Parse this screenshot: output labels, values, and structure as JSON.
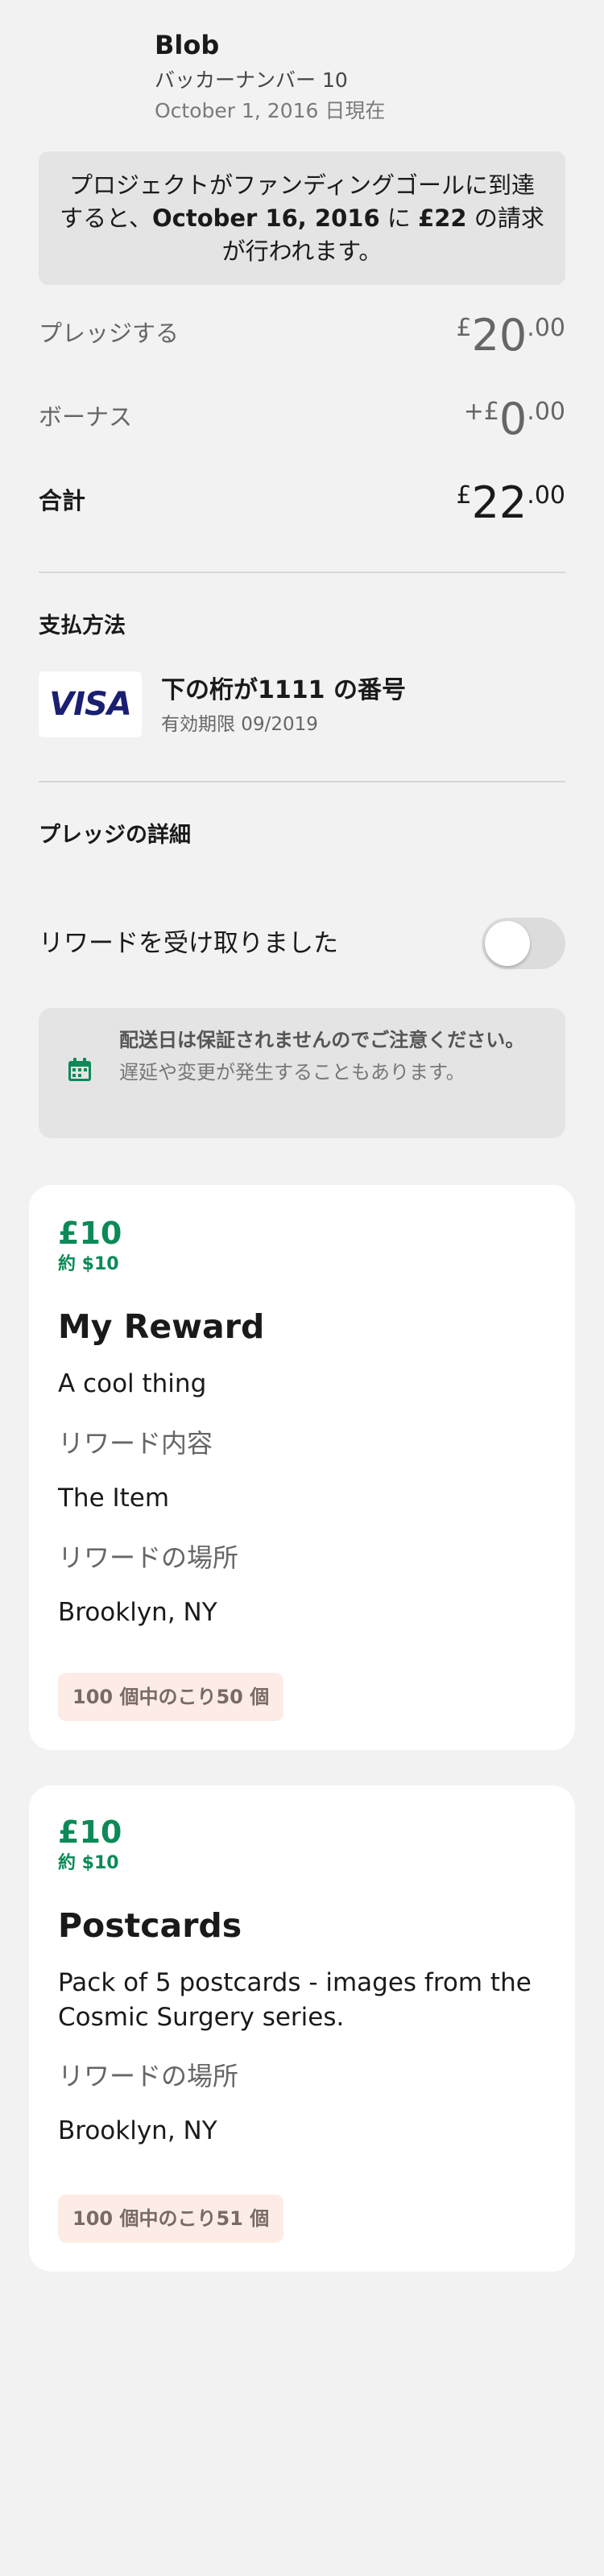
{
  "header": {
    "backer_name": "Blob",
    "backer_number": "バッカーナンバー 10",
    "as_of": "October 1, 2016 日現在"
  },
  "charge_notice": {
    "prefix": "プロジェクトがファンディングゴールに到達すると、",
    "date": "October 16, 2016",
    "mid": " に ",
    "amount": "£22",
    "suffix": " の請求が行われます。"
  },
  "summary": {
    "pledge": {
      "label": "プレッジする",
      "currency": "£",
      "integer": "20",
      "decimal": ".00"
    },
    "bonus": {
      "label": "ボーナス",
      "currency": "+£",
      "integer": "0",
      "decimal": ".00"
    },
    "total": {
      "label": "合計",
      "currency": "£",
      "integer": "22",
      "decimal": ".00"
    }
  },
  "payment": {
    "title": "支払方法",
    "card_brand": "VISA",
    "card_number": "下の桁が1111 の番号",
    "card_expiry": "有効期限 09/2019"
  },
  "pledge_details": {
    "title": "プレッジの詳細",
    "reward_received_label": "リワードを受け取りました",
    "reward_received": false
  },
  "delivery_notice": {
    "bold": "配送日は保証されませんのでご注意ください。",
    "text": "遅延や変更が発生することもあります。"
  },
  "rewards": [
    {
      "price": "£10",
      "approx": "約 $10",
      "title": "My Reward",
      "description": "A cool thing",
      "items_label": "リワード内容",
      "items": "The Item",
      "location_label": "リワードの場所",
      "location": "Brooklyn, NY",
      "remaining": "100 個中のこり50 個"
    },
    {
      "price": "£10",
      "approx": "約 $10",
      "title": "Postcards",
      "description": "Pack of 5 postcards - images from the Cosmic Surgery series.",
      "location_label": "リワードの場所",
      "location": "Brooklyn, NY",
      "remaining": "100 個中のこり51 個"
    }
  ],
  "colors": {
    "accent_green": "#0b8a57",
    "background": "#f2f2f2",
    "visa_blue": "#1a1f71",
    "badge_bg": "#fdece6"
  },
  "icons": {
    "calendar": "calendar-icon"
  }
}
